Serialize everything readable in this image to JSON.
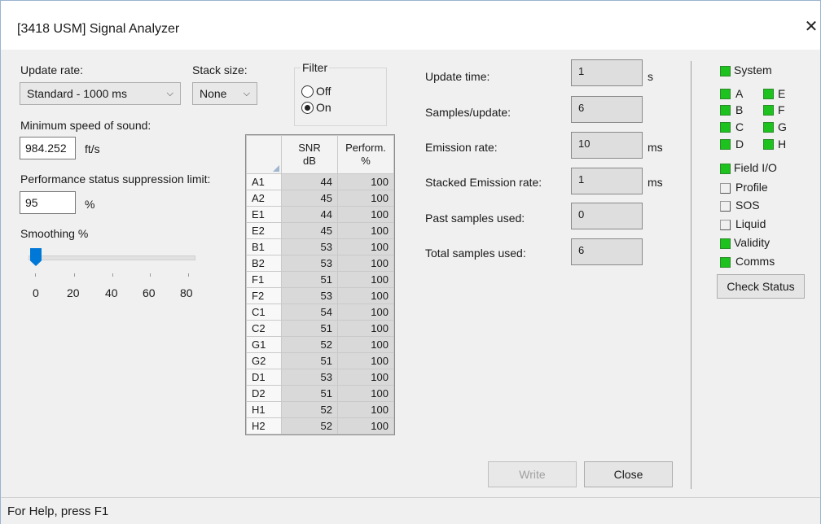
{
  "window": {
    "title": "[3418 USM] Signal Analyzer"
  },
  "update_rate": {
    "label": "Update rate:",
    "value": "Standard - 1000 ms"
  },
  "stack_size": {
    "label": "Stack size:",
    "value": "None"
  },
  "filter": {
    "label": "Filter",
    "options": [
      "Off",
      "On"
    ],
    "selected": "On"
  },
  "min_sos": {
    "label": "Minimum speed of sound:",
    "value": "984.252",
    "unit": "ft/s"
  },
  "perf_limit": {
    "label": "Performance status suppression limit:",
    "value": "95",
    "unit": "%"
  },
  "smoothing": {
    "label": "Smoothing %",
    "value": 0,
    "ticks": [
      "0",
      "20",
      "40",
      "60",
      "80"
    ]
  },
  "grid": {
    "col1": "SNR\ndB",
    "col2": "Perform.\n%",
    "rows": [
      {
        "ch": "A1",
        "snr": "44",
        "perf": "100"
      },
      {
        "ch": "A2",
        "snr": "45",
        "perf": "100"
      },
      {
        "ch": "E1",
        "snr": "44",
        "perf": "100"
      },
      {
        "ch": "E2",
        "snr": "45",
        "perf": "100"
      },
      {
        "ch": "B1",
        "snr": "53",
        "perf": "100"
      },
      {
        "ch": "B2",
        "snr": "53",
        "perf": "100"
      },
      {
        "ch": "F1",
        "snr": "51",
        "perf": "100"
      },
      {
        "ch": "F2",
        "snr": "53",
        "perf": "100"
      },
      {
        "ch": "C1",
        "snr": "54",
        "perf": "100"
      },
      {
        "ch": "C2",
        "snr": "51",
        "perf": "100"
      },
      {
        "ch": "G1",
        "snr": "52",
        "perf": "100"
      },
      {
        "ch": "G2",
        "snr": "51",
        "perf": "100"
      },
      {
        "ch": "D1",
        "snr": "53",
        "perf": "100"
      },
      {
        "ch": "D2",
        "snr": "51",
        "perf": "100"
      },
      {
        "ch": "H1",
        "snr": "52",
        "perf": "100"
      },
      {
        "ch": "H2",
        "snr": "52",
        "perf": "100"
      }
    ]
  },
  "stats": {
    "update_time": {
      "label": "Update time:",
      "value": "1",
      "unit": "s"
    },
    "samples_update": {
      "label": "Samples/update:",
      "value": "6",
      "unit": ""
    },
    "emission_rate": {
      "label": "Emission rate:",
      "value": "10",
      "unit": "ms"
    },
    "stacked_emission": {
      "label": "Stacked Emission rate:",
      "value": "1",
      "unit": "ms"
    },
    "past_samples": {
      "label": "Past samples used:",
      "value": "0",
      "unit": ""
    },
    "total_samples": {
      "label": "Total samples used:",
      "value": "6",
      "unit": ""
    }
  },
  "status": {
    "system": "System",
    "paths": [
      "A",
      "E",
      "B",
      "F",
      "C",
      "G",
      "D",
      "H"
    ],
    "field_io": "Field I/O",
    "profile": "Profile",
    "sos": "SOS",
    "liquid": "Liquid",
    "validity": "Validity",
    "comms": "Comms",
    "check_button": "Check Status",
    "green_color": "#1ec21e"
  },
  "buttons": {
    "write": "Write",
    "close": "Close"
  },
  "statusbar": {
    "text": "For Help, press F1"
  }
}
